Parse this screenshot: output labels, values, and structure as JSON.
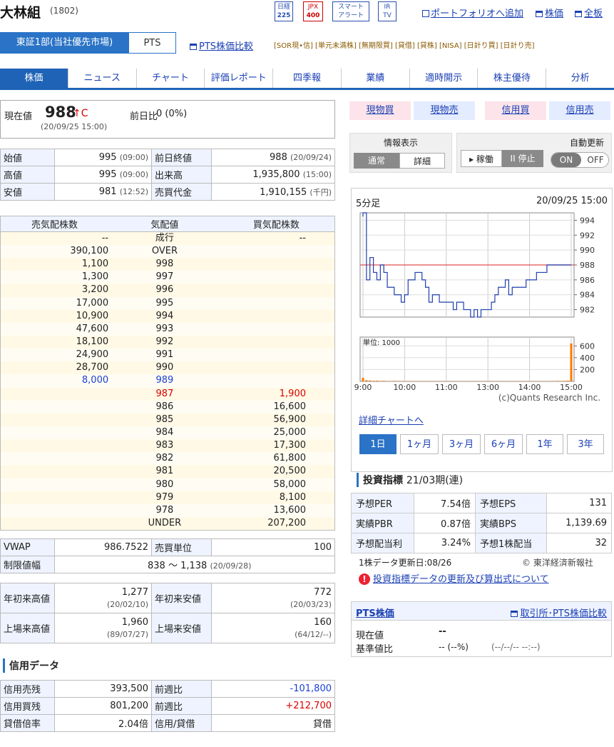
{
  "header": {
    "name": "大林組",
    "code": "(1802)",
    "badges": [
      {
        "line1": "日経",
        "line2": "225"
      },
      {
        "line1": "JPX",
        "line2": "400"
      },
      {
        "line1": "スマート",
        "line2": "アラート"
      },
      {
        "line1": "IR",
        "line2": "TV"
      }
    ],
    "links": [
      "ポートフォリオへ追加",
      "株価",
      "全板"
    ]
  },
  "market_tabs": [
    "東証1部(当社優先市場)",
    "PTS"
  ],
  "pts_compare_link": "PTS株価比較",
  "tags": "[SOR現•信] [単元未満株] [無期限買] [貸借] [貸株] [NISA] [日計り買] [日計り売]",
  "nav": [
    "株価",
    "ニュース",
    "チャート",
    "評価レポート",
    "四季報",
    "業績",
    "適時開示",
    "株主優待",
    "分析"
  ],
  "current": {
    "label": "現在値",
    "price": "988",
    "arrow": "↑C",
    "time": "(20/09/25 15:00)",
    "change_label": "前日比",
    "change": "0 (0%)"
  },
  "quote_table": [
    {
      "l1": "始値",
      "v1": "995",
      "t1": "(09:00)",
      "l2": "前日終値",
      "v2": "988",
      "t2": "(20/09/24)"
    },
    {
      "l1": "高値",
      "v1": "995",
      "t1": "(09:00)",
      "l2": "出来高",
      "v2": "1,935,800",
      "t2": "(15:00)"
    },
    {
      "l1": "安値",
      "v1": "981",
      "t1": "(12:52)",
      "l2": "売買代金",
      "v2": "1,910,155",
      "t2": "(千円)"
    }
  ],
  "board": {
    "headers": [
      "売気配株数",
      "気配値",
      "買気配株数"
    ],
    "rows": [
      [
        "--",
        "成行",
        "--"
      ],
      [
        "390,100",
        "OVER",
        ""
      ],
      [
        "1,100",
        "998",
        ""
      ],
      [
        "1,300",
        "997",
        ""
      ],
      [
        "3,200",
        "996",
        ""
      ],
      [
        "17,000",
        "995",
        ""
      ],
      [
        "10,900",
        "994",
        ""
      ],
      [
        "47,600",
        "993",
        ""
      ],
      [
        "18,100",
        "992",
        ""
      ],
      [
        "24,900",
        "991",
        ""
      ],
      [
        "28,700",
        "990",
        ""
      ],
      [
        "8,000",
        "989",
        ""
      ],
      [
        "",
        "987",
        "1,900"
      ],
      [
        "",
        "986",
        "16,600"
      ],
      [
        "",
        "985",
        "56,900"
      ],
      [
        "",
        "984",
        "25,000"
      ],
      [
        "",
        "983",
        "17,300"
      ],
      [
        "",
        "982",
        "61,800"
      ],
      [
        "",
        "981",
        "20,500"
      ],
      [
        "",
        "980",
        "58,000"
      ],
      [
        "",
        "979",
        "8,100"
      ],
      [
        "",
        "978",
        "13,600"
      ],
      [
        "",
        "UNDER",
        "207,200"
      ]
    ]
  },
  "vwap_table": [
    {
      "l1": "VWAP",
      "v1": "986.7522",
      "l2": "売買単位",
      "v2": "100"
    }
  ],
  "limit": {
    "label": "制限値幅",
    "value": "838 〜 1,138",
    "date": "(20/09/28)"
  },
  "range_table": [
    {
      "l1": "年初来高値",
      "v1": "1,277",
      "d1": "(20/02/10)",
      "l2": "年初来安値",
      "v2": "772",
      "d2": "(20/03/23)"
    },
    {
      "l1": "上場来高値",
      "v1": "1,960",
      "d1": "(89/07/27)",
      "l2": "上場来安値",
      "v2": "160",
      "d2": "(64/12/--)"
    }
  ],
  "margin": {
    "title": "信用データ",
    "rows": [
      {
        "l1": "信用売残",
        "v1": "393,500",
        "l2": "前週比",
        "v2": "-101,800",
        "color": "blue"
      },
      {
        "l1": "信用買残",
        "v1": "801,200",
        "l2": "前週比",
        "v2": "+212,700",
        "color": "red"
      },
      {
        "l1": "貸借倍率",
        "v1": "2.04倍",
        "l2": "信用/貸借",
        "v2": "貸借",
        "color": ""
      }
    ]
  },
  "trade_buttons": [
    "現物買",
    "現物売",
    "信用買",
    "信用売"
  ],
  "info": {
    "title": "情報表示",
    "opt1": "通常",
    "opt2": "詳細"
  },
  "auto": {
    "title": "自動更新",
    "run": "▸ 稼働",
    "stop": "II 停止",
    "on": "ON",
    "off": "OFF"
  },
  "chart": {
    "label": "5分足",
    "datetime": "20/09/25 15:00",
    "price_ticks": [
      "994",
      "992",
      "990",
      "988",
      "986",
      "984",
      "982"
    ],
    "volume_unit": "単位: 1000",
    "volume_ticks": [
      "600",
      "400",
      "200"
    ],
    "time_ticks": [
      "9:00",
      "10:00",
      "11:00",
      "13:00",
      "14:00",
      "15:00"
    ],
    "credit": "(c)Quants Research Inc.",
    "detail_link": "詳細チャートへ",
    "periods": [
      "1日",
      "1ヶ月",
      "3ヶ月",
      "6ヶ月",
      "1年",
      "3年"
    ],
    "line_color": "#1f3fb0",
    "ref_color": "#e05050",
    "vol_color": "#ff7a00"
  },
  "chart_data": {
    "type": "line",
    "x": [
      "9:00",
      "9:05",
      "9:10",
      "9:15",
      "9:20",
      "9:25",
      "9:30",
      "9:35",
      "9:40",
      "9:45",
      "9:50",
      "9:55",
      "10:00",
      "10:05",
      "10:10",
      "10:15",
      "10:20",
      "10:25",
      "10:30",
      "10:35",
      "10:40",
      "10:45",
      "10:50",
      "10:55",
      "11:00",
      "11:05",
      "11:10",
      "11:15",
      "11:20",
      "11:25",
      "12:30",
      "12:35",
      "12:40",
      "12:45",
      "12:50",
      "12:55",
      "13:00",
      "13:05",
      "13:10",
      "13:15",
      "13:20",
      "13:25",
      "13:30",
      "13:35",
      "13:40",
      "13:45",
      "13:50",
      "13:55",
      "14:00",
      "14:05",
      "14:10",
      "14:15",
      "14:20",
      "14:25",
      "14:30",
      "14:35",
      "14:40",
      "14:45",
      "14:50",
      "14:55",
      "15:00"
    ],
    "series": [
      {
        "values": [
          995,
          986,
          989,
          987,
          986,
          988,
          987,
          985,
          985,
          984,
          984,
          983,
          984,
          986,
          986,
          987,
          987,
          986,
          985,
          983,
          984,
          984,
          983,
          983,
          983,
          983,
          982,
          983,
          983,
          982,
          982,
          981,
          982,
          981,
          982,
          982,
          982,
          983,
          984,
          985,
          985,
          986,
          984,
          985,
          985,
          985,
          985,
          986,
          986,
          986,
          987,
          987,
          987,
          988,
          988,
          988,
          988,
          988,
          988,
          988,
          988
        ]
      }
    ],
    "volume": [
      60,
      20,
      15,
      10,
      12,
      8,
      10,
      6,
      5,
      8,
      6,
      5,
      6,
      5,
      4,
      5,
      6,
      4,
      5,
      5,
      4,
      6,
      4,
      3,
      4,
      3,
      2,
      3,
      3,
      4,
      3,
      5,
      4,
      3,
      3,
      4,
      3,
      4,
      5,
      3,
      4,
      3,
      4,
      3,
      3,
      4,
      5,
      3,
      4,
      3,
      3,
      4,
      3,
      4,
      5,
      6,
      8,
      7,
      9,
      12,
      640
    ],
    "ylim": [
      981,
      995
    ],
    "volume_ylim": [
      0,
      700
    ]
  },
  "indicators": {
    "title": "投資指標",
    "period": "21/03期(連)",
    "rows": [
      {
        "l1": "予想PER",
        "v1": "7.54倍",
        "l2": "予想EPS",
        "v2": "131"
      },
      {
        "l1": "実績PBR",
        "v1": "0.87倍",
        "l2": "実績BPS",
        "v2": "1,139.69"
      },
      {
        "l1": "予想配当利",
        "v1": "3.24%",
        "l2": "予想1株配当",
        "v2": "32"
      }
    ],
    "update": "1株データ更新日:08/26",
    "source": "© 東洋経済新報社",
    "note_link": "投資指標データの更新及び算出式について"
  },
  "pts": {
    "title": "PTS株価",
    "compare_link": "取引所･PTS株価比較",
    "cur_label": "現在値",
    "cur_value": "--",
    "base_label": "基準値比",
    "base_value": "-- (--%)",
    "base_time": "(--/--/-- --:--)"
  }
}
